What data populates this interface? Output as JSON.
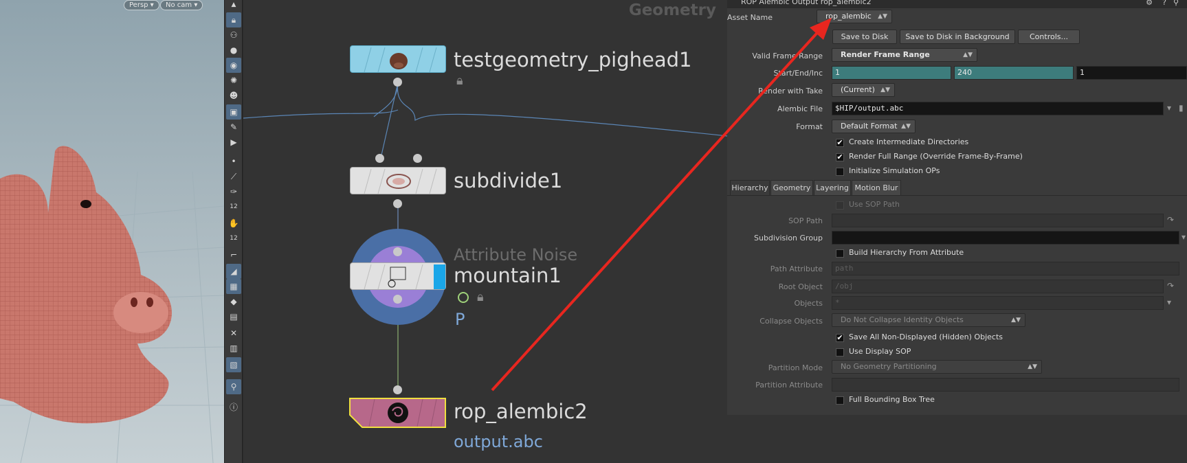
{
  "viewport": {
    "camera_menu": "Persp",
    "cam_menu": "No cam"
  },
  "toolbar": {
    "items": [
      "lock-icon",
      "pose-icon",
      "sphere-icon",
      "light-icon",
      "bulb-icon",
      "person-icon",
      "shader-icon",
      "brush-icon",
      "video-icon",
      "dot-icon",
      "edge-icon",
      "pen-icon",
      "numbers-icon",
      "handle-icon",
      "numbers2-icon",
      "corner-icon",
      "snap-icon",
      "grid-icon",
      "diamond-icon",
      "map-icon",
      "cross-icon",
      "display-icon",
      "frame-icon",
      "pin-icon",
      "info-icon"
    ],
    "numbers_label": "12"
  },
  "network": {
    "context_label": "Geometry",
    "nodes": [
      {
        "name": "testgeometry_pighead1",
        "color": "#8fd0e6"
      },
      {
        "name": "subdivide1",
        "color": "#e1e1e1"
      },
      {
        "type": "Attribute Noise",
        "name": "mountain1",
        "badge": "P",
        "color": "#e1e1e1"
      },
      {
        "name": "rop_alembic2",
        "output": "output.abc",
        "color": "#b7688a"
      }
    ]
  },
  "params": {
    "header": "ROP Alembic Output  rop_alembic2",
    "asset_name_label": "Asset Name",
    "asset_name_value": "rop_alembic",
    "buttons": [
      "Save to Disk",
      "Save to Disk in Background",
      "Controls..."
    ],
    "valid_frame_range_label": "Valid Frame Range",
    "valid_frame_range_value": "Render Frame Range",
    "start_end_inc_label": "Start/End/Inc",
    "start": "1",
    "end": "240",
    "inc": "1",
    "render_with_take_label": "Render with Take",
    "render_with_take_value": "(Current)",
    "alembic_file_label": "Alembic File",
    "alembic_file_value": "$HIP/output.abc",
    "format_label": "Format",
    "format_value": "Default Format",
    "checks": [
      {
        "label": "Create Intermediate Directories",
        "checked": true
      },
      {
        "label": "Render Full Range (Override Frame-By-Frame)",
        "checked": true
      },
      {
        "label": "Initialize Simulation OPs",
        "checked": false
      }
    ],
    "tabs": [
      "Hierarchy",
      "Geometry",
      "Layering",
      "Motion Blur"
    ],
    "hierarchy": {
      "use_sop_path": "Use SOP Path",
      "sop_path_label": "SOP Path",
      "subdivision_group_label": "Subdivision Group",
      "build_hierarchy_label": "Build Hierarchy From Attribute",
      "path_attribute_label": "Path Attribute",
      "path_attribute_value": "path",
      "root_object_label": "Root Object",
      "root_object_value": "/obj",
      "objects_label": "Objects",
      "objects_value": "*",
      "collapse_objects_label": "Collapse Objects",
      "collapse_objects_value": "Do Not Collapse Identity Objects",
      "save_hidden_label": "Save All Non-Displayed (Hidden) Objects",
      "use_display_sop_label": "Use Display SOP",
      "partition_mode_label": "Partition Mode",
      "partition_mode_value": "No Geometry Partitioning",
      "partition_attribute_label": "Partition Attribute",
      "full_bbox_label": "Full Bounding Box Tree"
    }
  },
  "annotation": {
    "color": "#e8261f"
  }
}
